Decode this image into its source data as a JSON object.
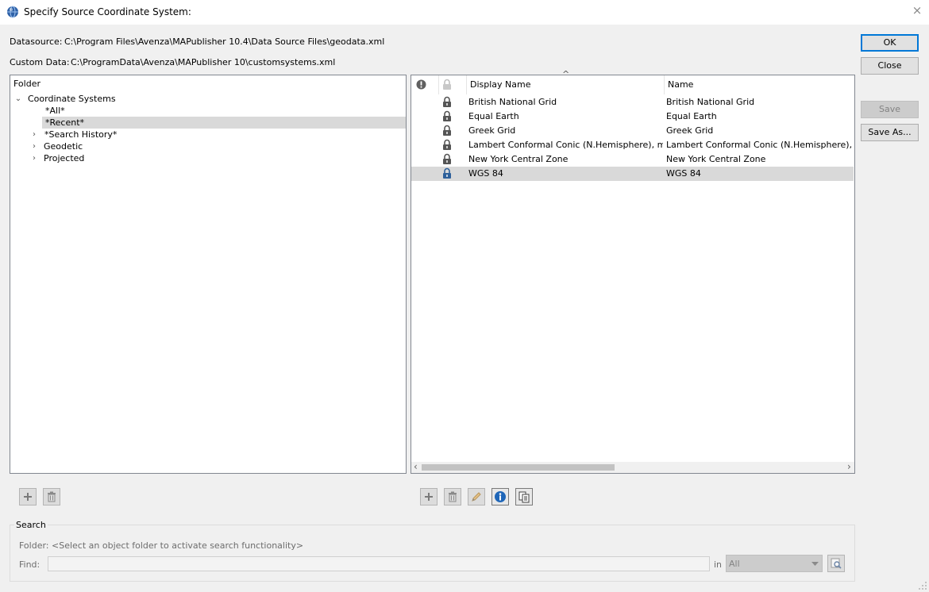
{
  "window": {
    "title": "Specify Source Coordinate System:",
    "close_glyph": "×"
  },
  "header": {
    "datasource_label": "Datasource:",
    "datasource_value": "C:\\Program Files\\Avenza\\MAPublisher 10.4\\Data Source Files\\geodata.xml",
    "custom_label": "Custom Data:",
    "custom_value": "C:\\ProgramData\\Avenza\\MAPublisher 10\\customsystems.xml"
  },
  "buttons": {
    "ok": "OK",
    "close": "Close",
    "save": "Save",
    "save_as": "Save As..."
  },
  "folder_tree": {
    "header": "Folder",
    "root": "Coordinate Systems",
    "items": [
      "*All*",
      "*Recent*",
      "*Search History*",
      "Geodetic",
      "Projected"
    ]
  },
  "table": {
    "columns": [
      "Display Name",
      "Name"
    ],
    "sort_glyph": "^",
    "rows": [
      {
        "display": "British National Grid",
        "name": "British National Grid"
      },
      {
        "display": "Equal Earth",
        "name": "Equal Earth"
      },
      {
        "display": "Greek Grid",
        "name": "Greek Grid"
      },
      {
        "display": "Lambert Conformal Conic (N.Hemisphere), meter",
        "name": "Lambert Conformal Conic (N.Hemisphere), meter"
      },
      {
        "display": "New York Central Zone",
        "name": "New York Central Zone"
      },
      {
        "display": "WGS 84",
        "name": "WGS 84"
      }
    ],
    "selected_index": 5
  },
  "search": {
    "group_label": "Search",
    "folder_label": "Folder:",
    "folder_hint": "<Select an object folder to activate search functionality>",
    "find_label": "Find:",
    "find_value": "",
    "in_label": "in",
    "in_value": "All"
  },
  "icons": {
    "app": "globe-icon",
    "warning": "exclamation-icon",
    "lock": "lock-icon",
    "add": "plus-icon",
    "delete": "trash-icon",
    "edit": "pencil-icon",
    "info": "info-icon",
    "copy": "copy-icon",
    "search": "search-icon"
  },
  "colors": {
    "selection": "#d9d9d9",
    "default_border": "#0078d7",
    "lock_locked": "#555555",
    "lock_selected": "#2d5f9a"
  }
}
